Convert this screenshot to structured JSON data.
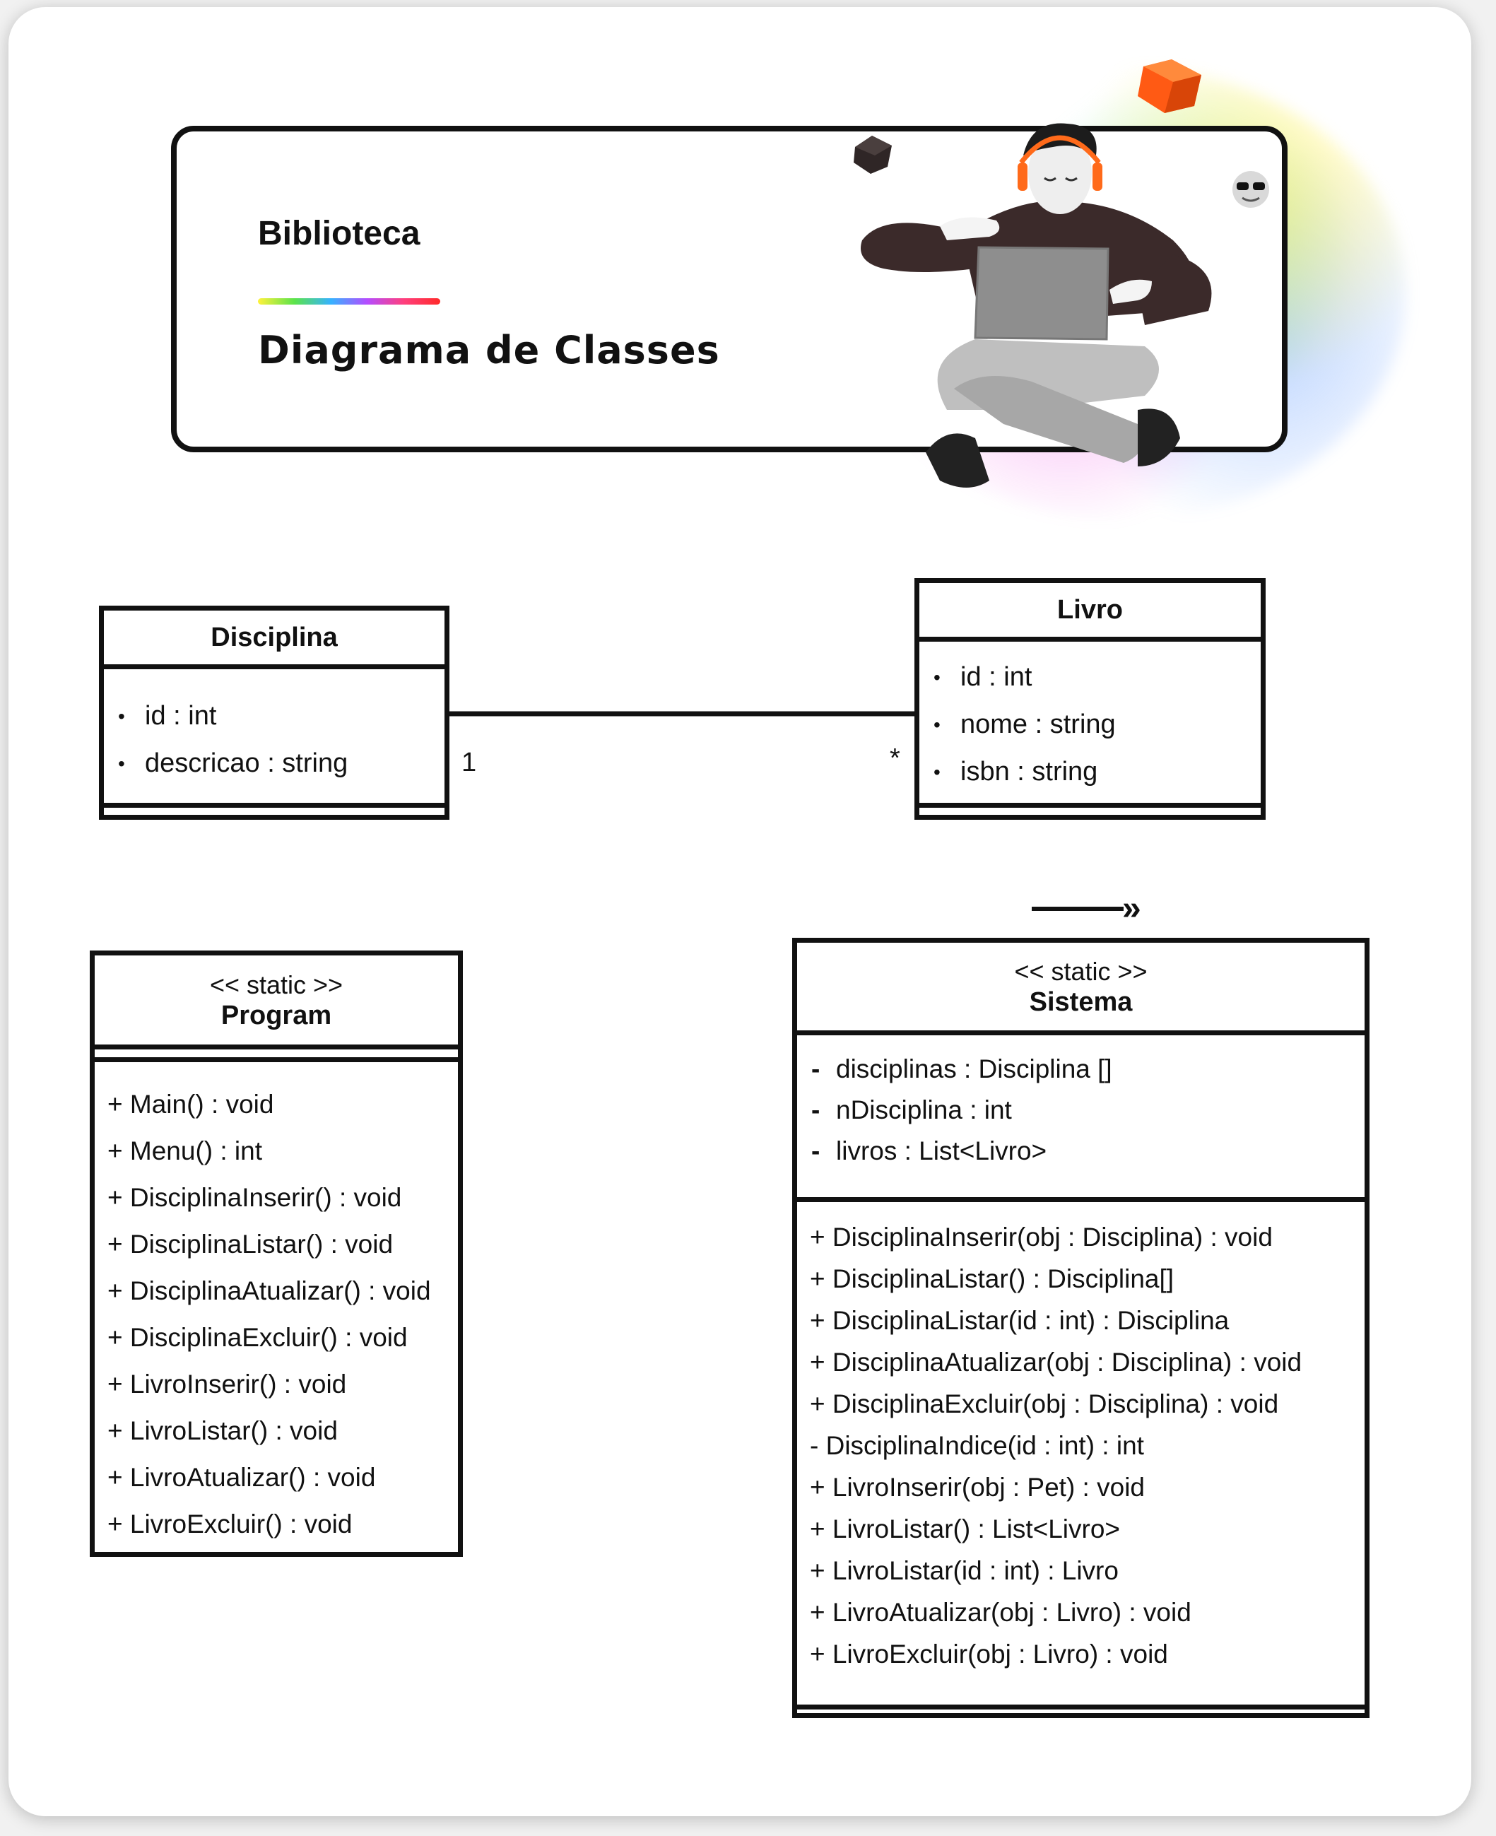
{
  "header": {
    "app_title": "Biblioteca",
    "subtitle": "Diagrama de Classes"
  },
  "classes": {
    "disciplina": {
      "name": "Disciplina",
      "attributes": [
        "id : int",
        "descricao : string"
      ]
    },
    "livro": {
      "name": "Livro",
      "attributes": [
        "id : int",
        "nome : string",
        "isbn : string"
      ]
    },
    "program": {
      "stereotype": "<< static >>",
      "name": "Program",
      "operations": [
        "+ Main() : void",
        "+ Menu() : int",
        "+ DisciplinaInserir() : void",
        "+ DisciplinaListar() : void",
        "+ DisciplinaAtualizar() : void",
        "+ DisciplinaExcluir() : void",
        "+ LivroInserir() : void",
        "+ LivroListar() : void",
        "+ LivroAtualizar() : void",
        "+ LivroExcluir() : void"
      ]
    },
    "sistema": {
      "stereotype": "<< static >>",
      "name": "Sistema",
      "attributes": [
        "disciplinas : Disciplina []",
        "nDisciplina : int",
        "livros : List<Livro>"
      ],
      "operations": [
        "+ DisciplinaInserir(obj : Disciplina) : void",
        "+ DisciplinaListar() : Disciplina[]",
        "+ DisciplinaListar(id : int) : Disciplina",
        "+ DisciplinaAtualizar(obj : Disciplina) : void",
        "+ DisciplinaExcluir(obj : Disciplina) : void",
        "- DisciplinaIndice(id : int) : int",
        "+ LivroInserir(obj : Pet) : void",
        "+ LivroListar() : List<Livro>",
        "+ LivroListar(id : int) : Livro",
        "+ LivroAtualizar(obj : Livro) : void",
        "+ LivroExcluir(obj : Livro) : void"
      ]
    }
  },
  "association": {
    "multiplicity_disciplina": "1",
    "multiplicity_livro": "*"
  },
  "arrow_symbol": "»",
  "colors": {
    "ink": "#111111",
    "page": "#ffffff",
    "backdrop": "#f1f1f1"
  }
}
